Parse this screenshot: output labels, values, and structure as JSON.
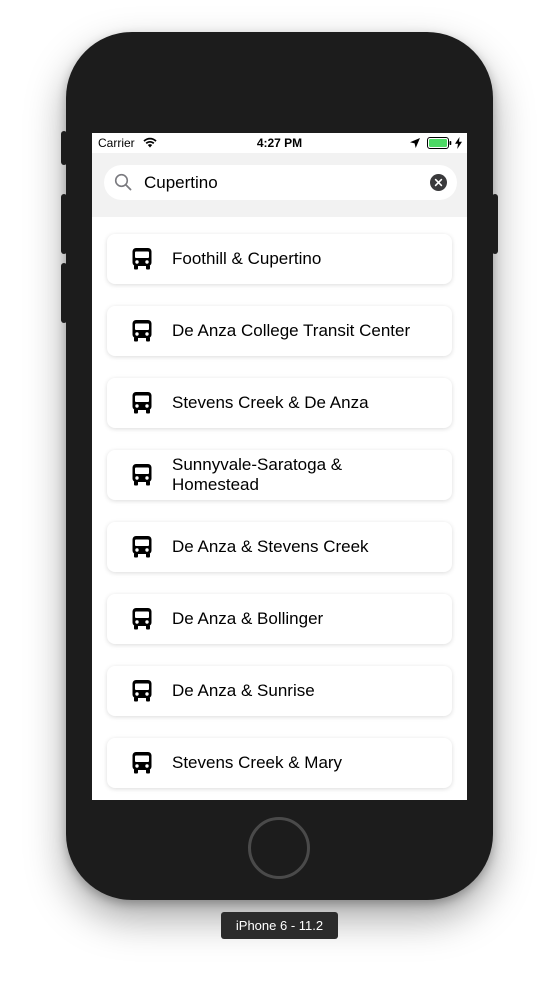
{
  "status_bar": {
    "carrier": "Carrier",
    "time": "4:27 PM"
  },
  "search": {
    "value": "Cupertino",
    "icon": "magnifier-icon",
    "clear_icon": "clear-x-circle-icon"
  },
  "results": [
    {
      "label": "Foothill & Cupertino",
      "icon": "bus-icon"
    },
    {
      "label": "De Anza College Transit Center",
      "icon": "bus-icon"
    },
    {
      "label": "Stevens Creek & De Anza",
      "icon": "bus-icon"
    },
    {
      "label": "Sunnyvale-Saratoga & Homestead",
      "icon": "bus-icon"
    },
    {
      "label": "De Anza & Stevens Creek",
      "icon": "bus-icon"
    },
    {
      "label": "De Anza & Bollinger",
      "icon": "bus-icon"
    },
    {
      "label": "De Anza & Sunrise",
      "icon": "bus-icon"
    },
    {
      "label": "Stevens Creek & Mary",
      "icon": "bus-icon"
    }
  ],
  "device_label": "iPhone 6 - 11.2",
  "colors": {
    "device_body": "#1c1c1c",
    "search_background": "#f2f2f2",
    "battery": "#4cd964"
  }
}
